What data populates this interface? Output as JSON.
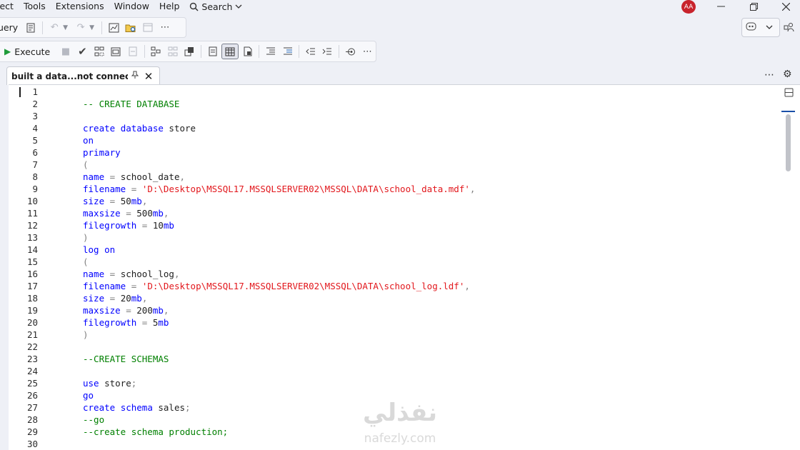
{
  "menubar": {
    "items": [
      "ject",
      "Tools",
      "Extensions",
      "Window",
      "Help"
    ],
    "search_label": "Search"
  },
  "account": {
    "initials": "AA"
  },
  "toolbar": {
    "query_label": "uery",
    "execute_label": "Execute"
  },
  "tab": {
    "title": "built a data...not connected"
  },
  "editor": {
    "line_numbers": [
      "1",
      "2",
      "3",
      "4",
      "5",
      "6",
      "7",
      "8",
      "9",
      "10",
      "11",
      "12",
      "13",
      "14",
      "15",
      "16",
      "17",
      "18",
      "19",
      "20",
      "21",
      "22",
      "23",
      "24",
      "25",
      "26",
      "27",
      "28",
      "29",
      "30"
    ],
    "lines": [
      "",
      "-- CREATE DATABASE",
      "",
      "create database store",
      "on",
      "primary",
      "(",
      "name = school_date,",
      "filename = 'D:\\Desktop\\MSSQL17.MSSQLSERVER02\\MSSQL\\DATA\\school_data.mdf',",
      "size = 50mb,",
      "maxsize = 500mb,",
      "filegrowth = 10mb",
      ")",
      "log on",
      "(",
      "name = school_log,",
      "filename = 'D:\\Desktop\\MSSQL17.MSSQLSERVER02\\MSSQL\\DATA\\school_log.ldf',",
      "size = 20mb,",
      "maxsize = 200mb,",
      "filegrowth = 5mb",
      ")",
      "",
      "--CREATE SCHEMAS",
      "",
      "use store;",
      "go",
      "create schema sales;",
      "--go",
      "--create schema production;",
      ""
    ]
  },
  "watermark": {
    "arabic_text": "نفذلي",
    "latin_text": "nafezly.com"
  },
  "colors": {
    "keyword": "#0000ff",
    "string": "#e2171c",
    "comment": "#008000",
    "punctuation": "#808080",
    "avatar_bg": "#c8232c",
    "execute_icon": "#1f9b3a"
  }
}
